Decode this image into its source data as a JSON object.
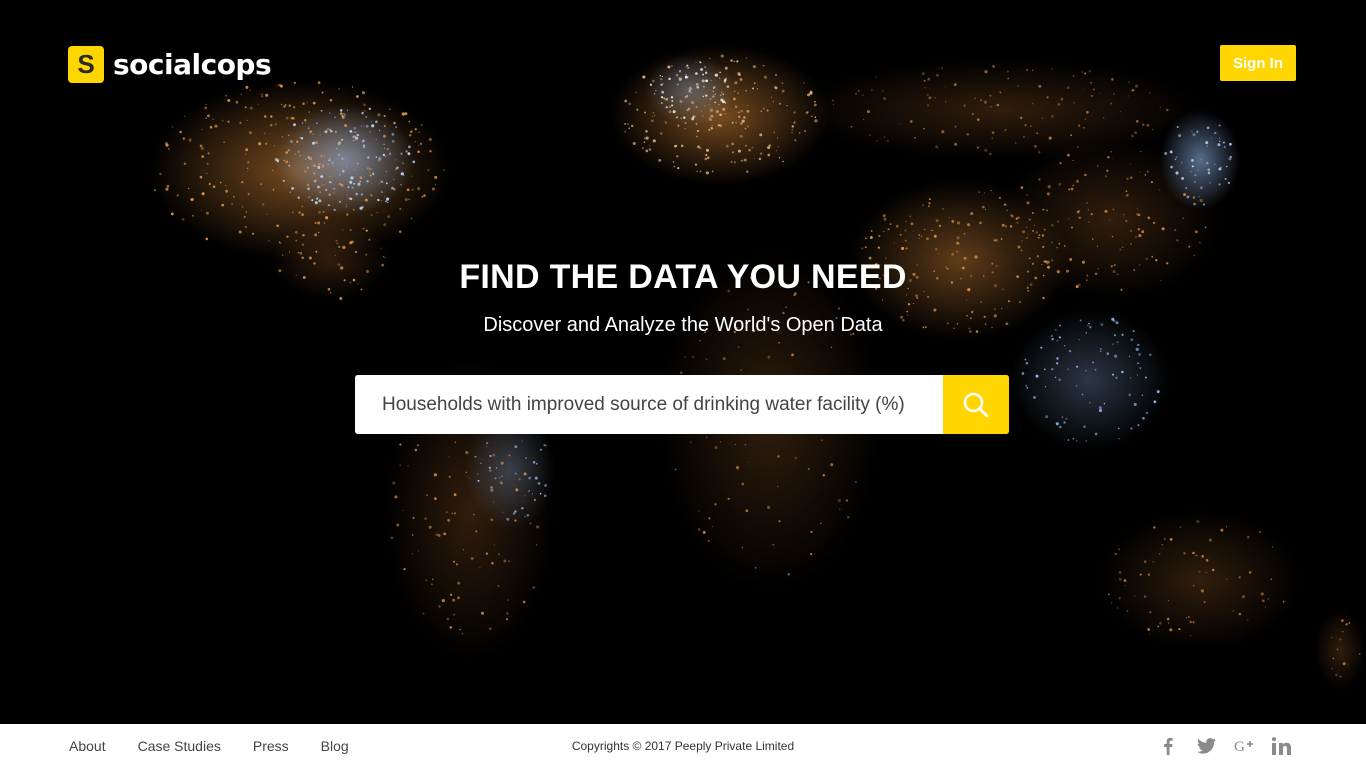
{
  "brand": {
    "logo_letter": "S",
    "name": "socialcops",
    "accent_color": "#ffd600"
  },
  "header": {
    "signin_label": "Sign In"
  },
  "hero": {
    "headline": "FIND THE DATA YOU NEED",
    "subheadline": "Discover and Analyze the World's Open Data",
    "background": "world-map-night-lights"
  },
  "search": {
    "value": "Households with improved source of drinking water facility (%)",
    "button_icon": "search-icon"
  },
  "footer": {
    "links": [
      "About",
      "Case Studies",
      "Press",
      "Blog"
    ],
    "copyright": "Copyrights © 2017 Peeply Private Limited",
    "social_icons": [
      "facebook-icon",
      "twitter-icon",
      "google-plus-icon",
      "linkedin-icon"
    ]
  }
}
